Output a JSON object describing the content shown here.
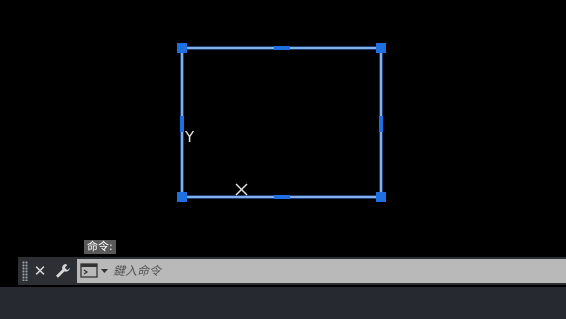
{
  "command_line": {
    "history_text": "命令:",
    "input_placeholder": "鍵入命令",
    "input_value": ""
  },
  "icons": {
    "close": "close-icon",
    "customize": "wrench-icon",
    "recent_commands": "command-prompt-icon",
    "ucs_y": "y-axis-icon",
    "ucs_x": "x-axis-icon"
  },
  "canvas_labels": {
    "ucs_y": "Y"
  },
  "colors": {
    "canvas_background": "#000000",
    "selected_geometry": "#3a7bd5",
    "grip": "#1e6fe0",
    "command_bar": "#2c2f33",
    "command_input": "#b9b9b9"
  }
}
